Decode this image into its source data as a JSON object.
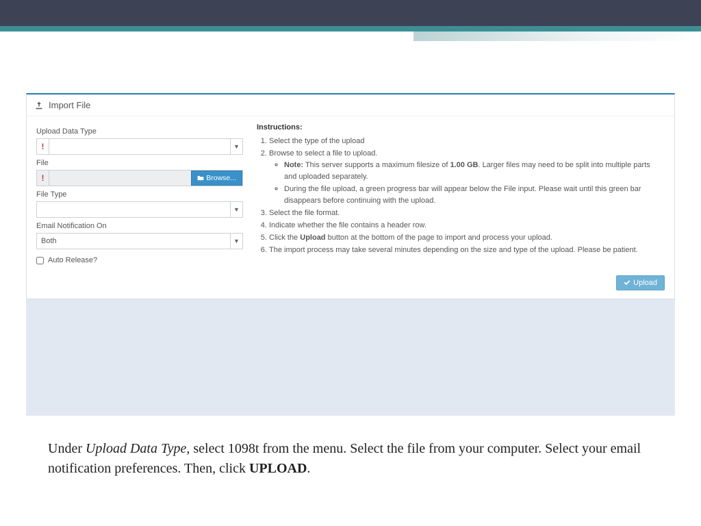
{
  "panel": {
    "title": "Import File",
    "labels": {
      "upload_data_type": "Upload Data Type",
      "file": "File",
      "file_type": "File Type",
      "email_notification_on": "Email Notification On",
      "auto_release": "Auto Release?"
    },
    "email_notification_value": "Both",
    "browse_label": "Browse...",
    "upload_button": "Upload",
    "required_mark": "!"
  },
  "instructions": {
    "heading": "Instructions:",
    "items": {
      "i1": "Select the type of the upload",
      "i2": "Browse to select a file to upload.",
      "note_label": "Note:",
      "note_a_pre": " This server supports a maximum filesize of ",
      "note_a_bold": "1.00 GB",
      "note_a_post": ". Larger files may need to be split into multiple parts and uploaded separately.",
      "note_b": "During the file upload, a green progress bar will appear below the File input. Please wait until this green bar disappears before continuing with the upload.",
      "i3": "Select the file format.",
      "i4": "Indicate whether the file contains a header row.",
      "i5_pre": "Click the ",
      "i5_bold": "Upload",
      "i5_post": " button at the bottom of the page to import and process your upload.",
      "i6": "The import process may take several minutes depending on the size and type of the upload. Please be patient."
    }
  },
  "caption": {
    "t1": "Under ",
    "em1": "Upload Data Type",
    "t2": ", select 1098t from the menu. Select the file from your computer. Select your email notification preferences. Then, click ",
    "strong1": "UPLOAD",
    "t3": "."
  }
}
